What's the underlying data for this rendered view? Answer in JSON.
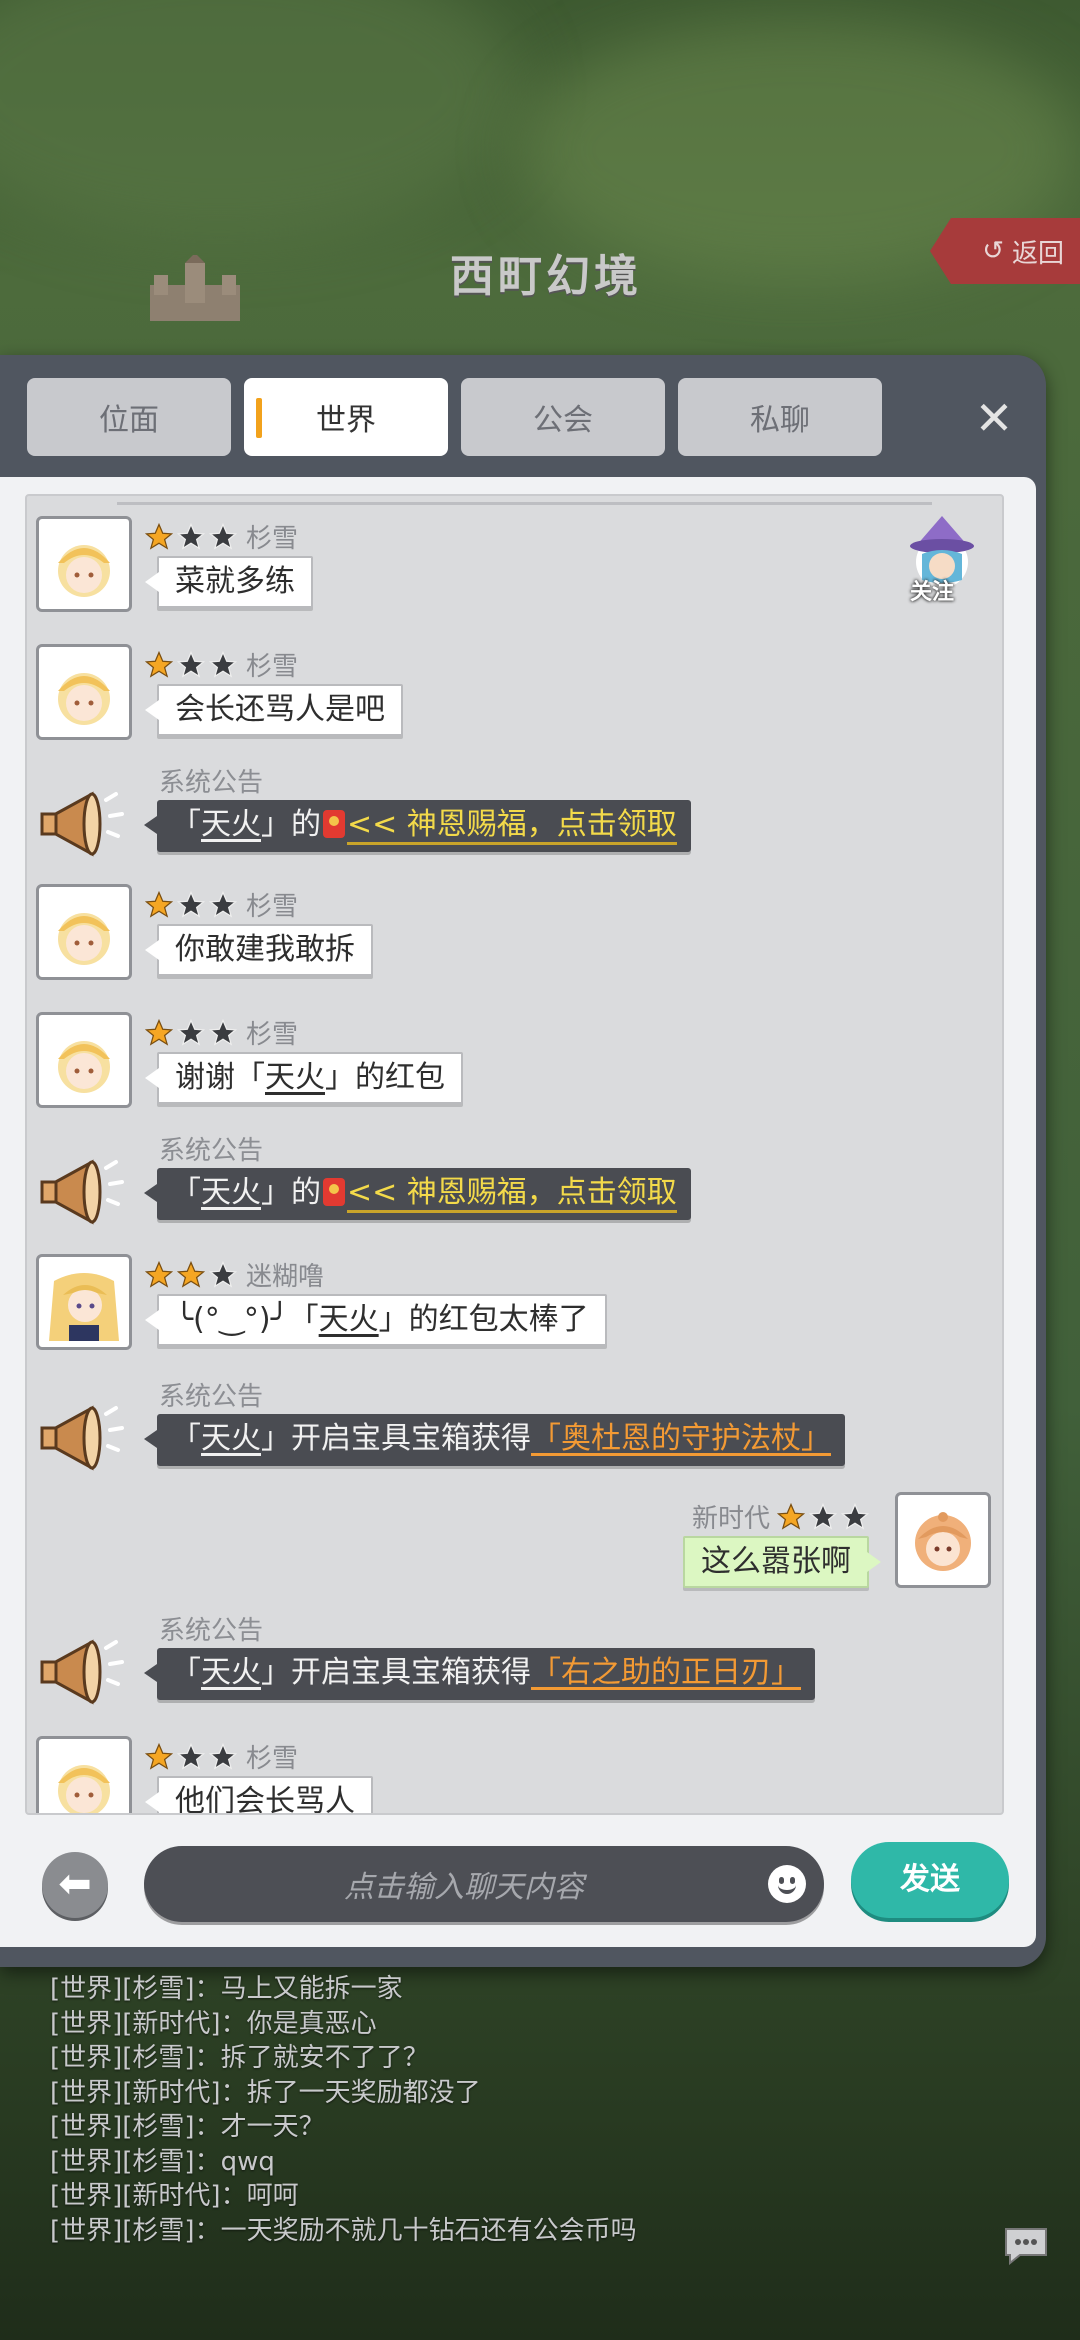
{
  "map": {
    "title": "西町幻境",
    "back_label": "返回"
  },
  "tabs": [
    {
      "label": "位面",
      "active": false
    },
    {
      "label": "世界",
      "active": true
    },
    {
      "label": "公会",
      "active": false
    },
    {
      "label": "私聊",
      "active": false
    }
  ],
  "follow_label": "关注",
  "messages": [
    {
      "type": "user",
      "name": "杉雪",
      "stars": 1,
      "text": "菜就多练"
    },
    {
      "type": "user",
      "name": "杉雪",
      "stars": 1,
      "text": "会长还骂人是吧"
    },
    {
      "type": "system",
      "label": "系统公告",
      "who": "天火",
      "mid": "的",
      "link": "<< 神恩赐福，点击领取"
    },
    {
      "type": "user",
      "name": "杉雪",
      "stars": 1,
      "text": "你敢建我敢拆"
    },
    {
      "type": "user",
      "name": "杉雪",
      "stars": 1,
      "text_pre": "谢谢「",
      "text_name": "天火",
      "text_post": "」的红包"
    },
    {
      "type": "system",
      "label": "系统公告",
      "who": "天火",
      "mid": "的",
      "link": "<< 神恩赐福，点击领取"
    },
    {
      "type": "user",
      "name": "迷糊噜",
      "stars": 2,
      "text_pre": "╰(°‿°)╯「",
      "text_name": "天火",
      "text_post": "」的红包太棒了"
    },
    {
      "type": "system",
      "label": "系统公告",
      "who": "天火",
      "mid": "开启宝具宝箱获得",
      "item": "「奥杜恩的守护法杖」"
    },
    {
      "type": "self",
      "name": "新时代",
      "stars": 1,
      "text": "这么嚣张啊"
    },
    {
      "type": "system",
      "label": "系统公告",
      "who": "天火",
      "mid": "开启宝具宝箱获得",
      "item": "「右之助的正日刃」"
    },
    {
      "type": "user",
      "name": "杉雪",
      "stars": 1,
      "text": "他们会长骂人"
    }
  ],
  "input": {
    "placeholder": "点击输入聊天内容",
    "send_label": "发送"
  },
  "world_log": [
    "[世界][杉雪]：马上又能拆一家",
    "[世界][新时代]：你是真恶心",
    "[世界][杉雪]：拆了就安不了了？",
    "[世界][新时代]：拆了一天奖励都没了",
    "[世界][杉雪]：才一天？",
    "[世界][杉雪]：qwq",
    "[世界][新时代]：呵呵",
    "[世界][杉雪]：一天奖励不就几十钻石还有公会币吗"
  ],
  "colors": {
    "accent_tab": "#f2a21c",
    "send_button": "#2fb8a8",
    "link_yellow": "#f3da4a",
    "item_orange": "#f39a34"
  }
}
